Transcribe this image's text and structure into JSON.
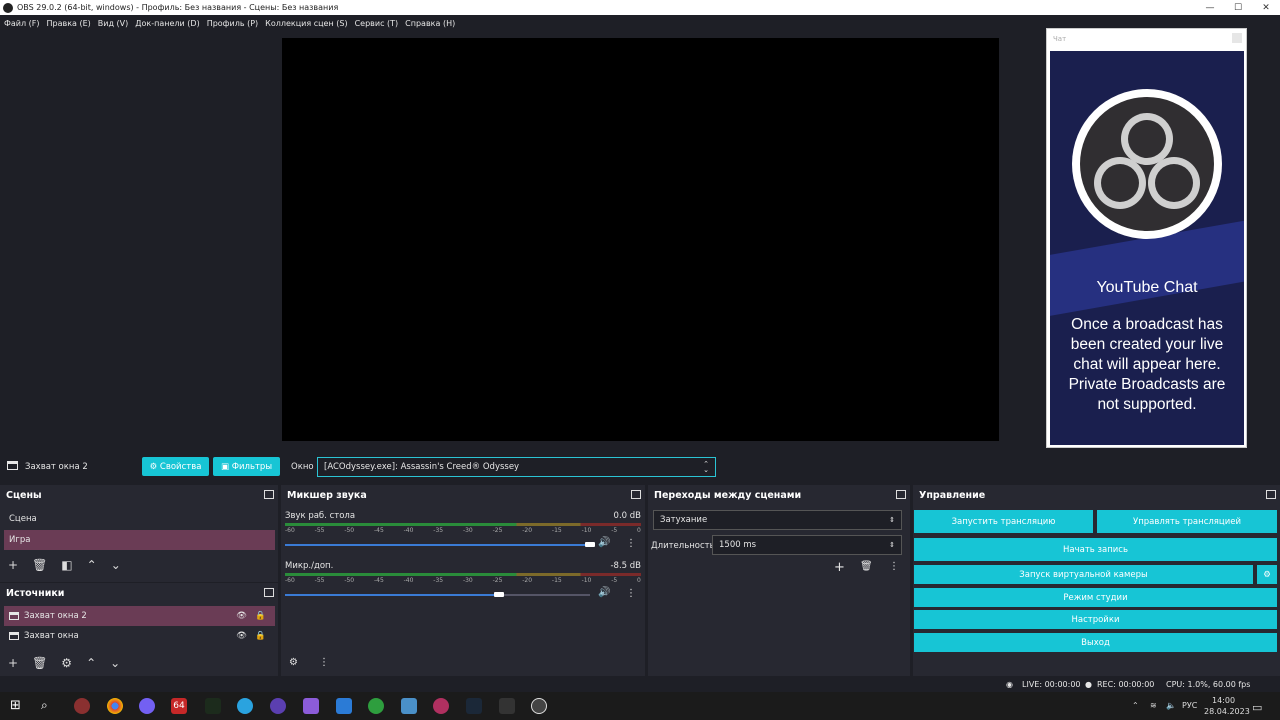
{
  "window": {
    "title": "OBS 29.0.2 (64-bit, windows) - Профиль: Без названия - Сцены: Без названия",
    "minimize": "—",
    "maximize": "☐",
    "close": "✕"
  },
  "menu": [
    "Файл (F)",
    "Правка (E)",
    "Вид (V)",
    "Док-панели (D)",
    "Профиль (P)",
    "Коллекция сцен (S)",
    "Сервис (T)",
    "Справка (H)"
  ],
  "chat": {
    "dock_title": "Чат",
    "heading": "YouTube Chat",
    "message": "Once a broadcast has been created your live chat will appear here. Private Broadcasts are not supported."
  },
  "source_toolbar": {
    "source_name": "Захват окна 2",
    "properties_label": "Свойства",
    "filters_label": "Фильтры",
    "window_label": "Окно",
    "window_value": "[ACOdyssey.exe]: Assassin's Creed® Odyssey"
  },
  "scenes": {
    "title": "Сцены",
    "items": [
      {
        "label": "Сцена",
        "selected": false
      },
      {
        "label": "Игра",
        "selected": true
      }
    ]
  },
  "sources": {
    "title": "Источники",
    "items": [
      {
        "label": "Захват окна 2",
        "selected": true
      },
      {
        "label": "Захват окна",
        "selected": false
      }
    ]
  },
  "mixer": {
    "title": "Микшер звука",
    "ticks": [
      "-60",
      "-55",
      "-50",
      "-45",
      "-40",
      "-35",
      "-30",
      "-25",
      "-20",
      "-15",
      "-10",
      "-5",
      "0"
    ],
    "channels": [
      {
        "name": "Звук раб. стола",
        "db": "0.0 dB",
        "volume": 1.0
      },
      {
        "name": "Микр./доп.",
        "db": "-8.5 dB",
        "volume": 0.7
      }
    ]
  },
  "transitions": {
    "title": "Переходы между сценами",
    "selected": "Затухание",
    "duration_label": "Длительность",
    "duration_value": "1500 ms"
  },
  "controls": {
    "title": "Управление",
    "start_stream": "Запустить трансляцию",
    "manage_stream": "Управлять трансляцией",
    "start_record": "Начать запись",
    "virtual_cam": "Запуск виртуальной камеры",
    "studio_mode": "Режим студии",
    "settings": "Настройки",
    "exit": "Выход"
  },
  "status": {
    "live": "LIVE: 00:00:00",
    "rec": "REC: 00:00:00",
    "cpu": "CPU: 1.0%, 60.00 fps"
  },
  "taskbar": {
    "lang": "РУС",
    "time": "14:00",
    "date": "28.04.2023",
    "badge_64": "64"
  },
  "colors": {
    "accent": "#17c5d5",
    "selected_row": "#6a3c55",
    "background": "#1e1f26",
    "panel": "#272831"
  }
}
